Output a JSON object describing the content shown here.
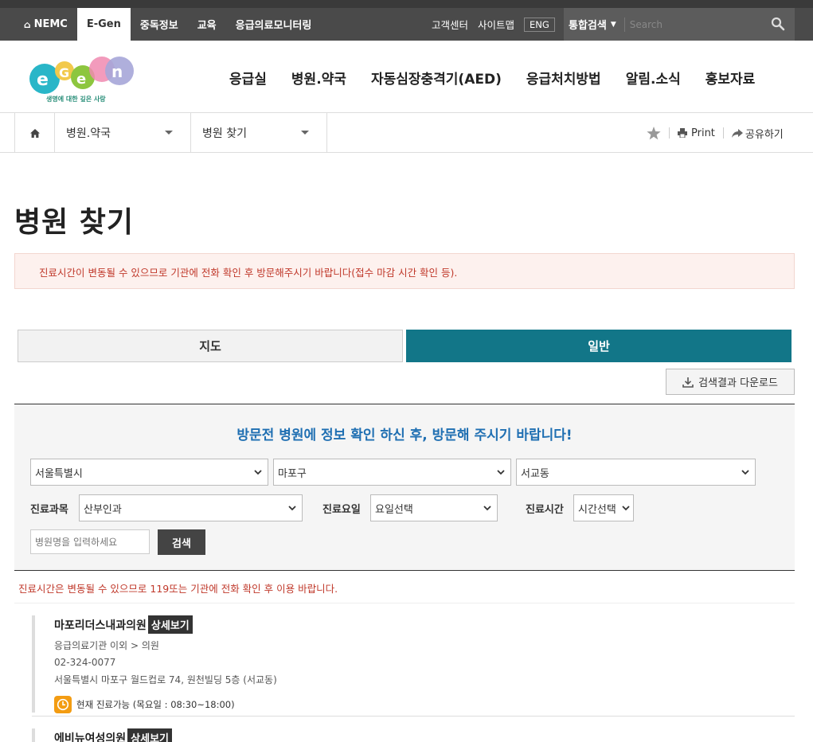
{
  "topbar": {
    "nemc": "NEMC",
    "items": [
      "E-Gen",
      "중독정보",
      "교육",
      "응급의료모니터링"
    ],
    "right_links": [
      "고객센터",
      "사이트맵"
    ],
    "eng": "ENG",
    "search_select": "통합검색",
    "search_placeholder": "Search"
  },
  "logo": {
    "tagline": "생명에 대한 깊은 사랑"
  },
  "gnb": [
    "응급실",
    "병원.약국",
    "자동심장충격기(AED)",
    "응급처치방법",
    "알림.소식",
    "홍보자료"
  ],
  "breadcrumb": {
    "level1": "병원.약국",
    "level2": "병원 찾기",
    "print": "Print",
    "share": "공유하기"
  },
  "page": {
    "title": "병원 찾기",
    "notice": "진료시간이 변동될 수 있으므로 기관에 전화 확인 후 방문해주시기 바랍니다(접수 마감 시간 확인 등)."
  },
  "tabs": {
    "map": "지도",
    "general": "일반"
  },
  "download_label": "검색결과 다운로드",
  "search_panel": {
    "title": "방문전 병원에 정보 확인 하신 후, 방문해 주시기 바랍니다!",
    "city": "서울특별시",
    "district": "마포구",
    "dong": "서교동",
    "dept_label": "진료과목",
    "dept_value": "산부인과",
    "day_label": "진료요일",
    "day_value": "요일선택",
    "time_label": "진료시간",
    "time_value": "시간선택",
    "name_placeholder": "병원명을 입력하세요",
    "search_button": "검색"
  },
  "warning": "진료시간은 변동될 수 있으므로 119또는 기관에 전화 확인 후 이용 바랍니다.",
  "results": [
    {
      "name": "마포리더스내과의원",
      "detail": "상세보기",
      "category": "응급의료기관 이외 > 의원",
      "phone": "02-324-0077",
      "address": "서울특별시 마포구 월드컵로 74, 원천빌딩 5층 (서교동)",
      "status": "현재 진료가능 (목요일 : 08:30~18:00)"
    },
    {
      "name": "에비뉴여성의원",
      "detail": "상세보기"
    }
  ],
  "colors": {
    "tab_active": "#127688",
    "panel_title": "#1f6fb2",
    "warning": "#c0392b",
    "clock": "#f39c12"
  }
}
